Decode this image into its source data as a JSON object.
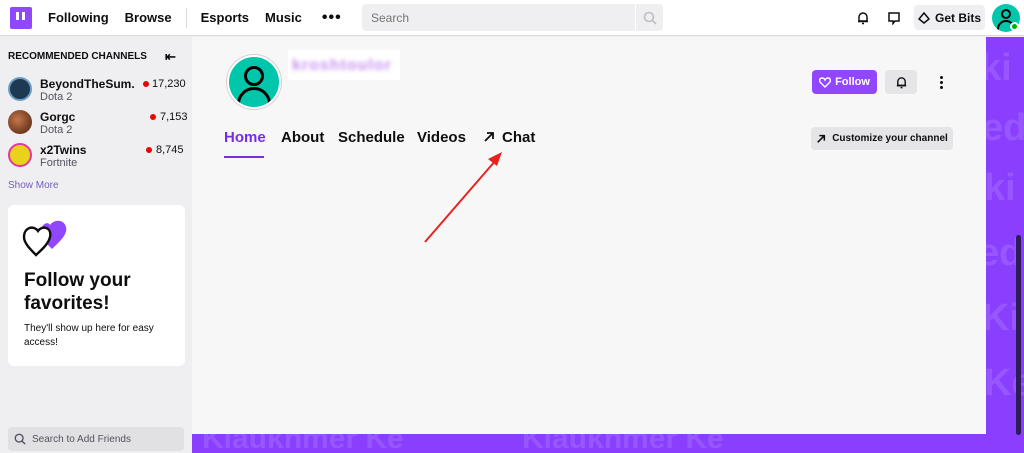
{
  "nav": {
    "links": [
      "Following",
      "Browse",
      "Esports",
      "Music"
    ],
    "more": "•••",
    "search_placeholder": "Search",
    "get_bits_label": "Get Bits"
  },
  "sidebar": {
    "section_title": "RECOMMENDED CHANNELS",
    "channels": [
      {
        "name": "BeyondTheSum...",
        "game": "Dota 2",
        "viewers": "17,230",
        "avatar_color": "#1d3a52"
      },
      {
        "name": "Gorgc",
        "game": "Dota 2",
        "viewers": "7,153",
        "avatar_color": "#7a3b1a"
      },
      {
        "name": "x2Twins",
        "game": "Fortnite",
        "viewers": "8,745",
        "avatar_color": "#e8d21c"
      }
    ],
    "show_more": "Show More",
    "promo": {
      "title": "Follow your favorites!",
      "text": "They'll show up here for easy access!"
    },
    "friends_search_placeholder": "Search to Add Friends"
  },
  "channel": {
    "display_name": "kroshtoulor",
    "follow_label": "Follow",
    "tabs": [
      "Home",
      "About",
      "Schedule",
      "Videos",
      "Chat"
    ],
    "active_tab": "Home",
    "customize_label": "Customize your channel"
  },
  "colors": {
    "brand": "#9147ff",
    "live": "#eb0400",
    "accent_text": "#772ce8",
    "annotation": "#e8231f"
  },
  "watermark": "Kiaukhmer Ke"
}
